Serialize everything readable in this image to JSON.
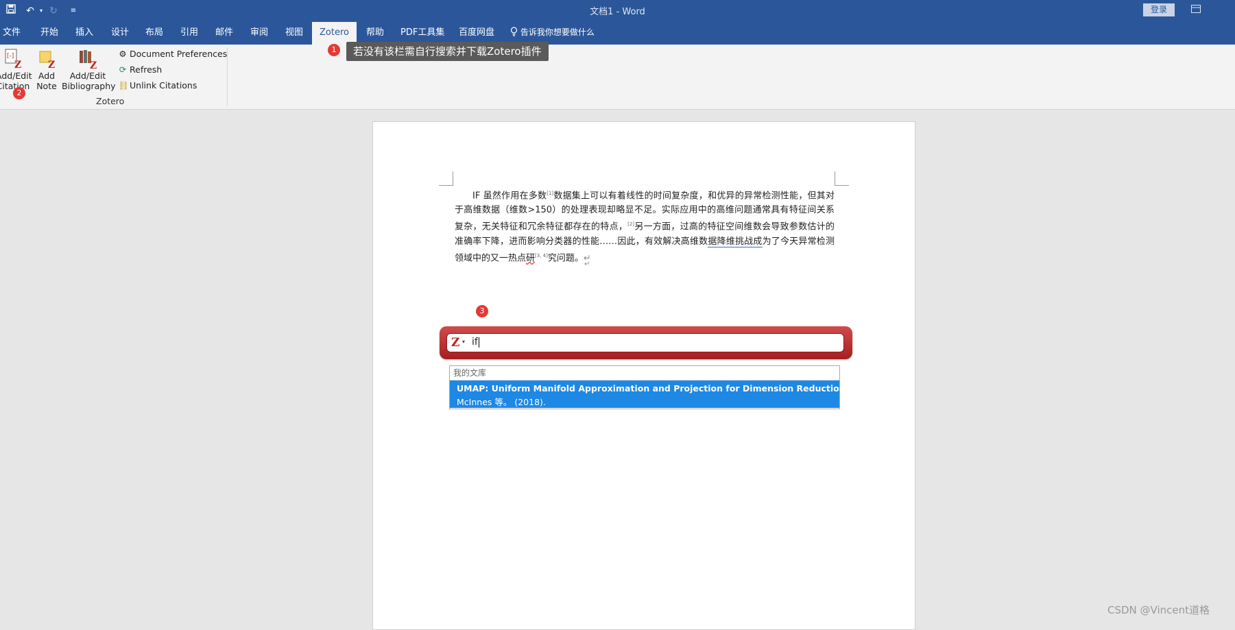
{
  "window": {
    "title": "文档1  -  Word",
    "login_label": "登录"
  },
  "tabs": [
    {
      "label": "文件"
    },
    {
      "label": "开始"
    },
    {
      "label": "插入"
    },
    {
      "label": "设计"
    },
    {
      "label": "布局"
    },
    {
      "label": "引用"
    },
    {
      "label": "邮件"
    },
    {
      "label": "审阅"
    },
    {
      "label": "视图"
    },
    {
      "label": "Zotero",
      "active": true
    },
    {
      "label": "帮助"
    },
    {
      "label": "PDF工具集"
    },
    {
      "label": "百度网盘"
    }
  ],
  "tell_me": "告诉我你想要做什么",
  "ribbon": {
    "add_edit_citation": [
      "Add/Edit",
      "Citation"
    ],
    "add_note": [
      "Add",
      "Note"
    ],
    "add_edit_bibliography": [
      "Add/Edit",
      "Bibliography"
    ],
    "document_preferences": "Document Preferences",
    "refresh": "Refresh",
    "unlink_citations": "Unlink Citations",
    "group_label": "Zotero"
  },
  "annotations": {
    "badge1": "1",
    "badge2": "2",
    "badge3": "3",
    "tooltip": "若没有该栏需自行搜索并下载Zotero插件"
  },
  "document": {
    "part1": "IF 虽然作用在多数",
    "sup1": "[1]",
    "part2": "数据集上可以有着线性的时间复杂度，和优异的异常检测性能，但其对于高维数据（维数>150）的处理表现却略显不足。实际应用中的高维问题通常具有特征间关系复杂，无关特征和冗余特征都存在的特点，",
    "sup2": "[2]",
    "part3": "另一方面，过高的特征空间维数会导致参数估计的准确率下降，进而影响分类器的性能……因此，有效解决高维数",
    "underlined": "据降维挑战成",
    "part4": "为了今天异常检测领域中的又一热点",
    "squiggle": "研",
    "sup3": "[3, 4]",
    "part5": "究问题。"
  },
  "zotero_search": {
    "query": "if",
    "library_header": "我的文库",
    "result_title": "UMAP: Uniform Manifold Approximation and Projection for Dimension Reduction",
    "result_sub": "McInnes 等。 (2018)."
  },
  "watermark": "CSDN @Vincent道格",
  "colors": {
    "word_blue": "#2b579a",
    "zotero_red": "#c41e1e",
    "highlight_blue": "#1e88e5",
    "badge_red": "#e53935"
  }
}
